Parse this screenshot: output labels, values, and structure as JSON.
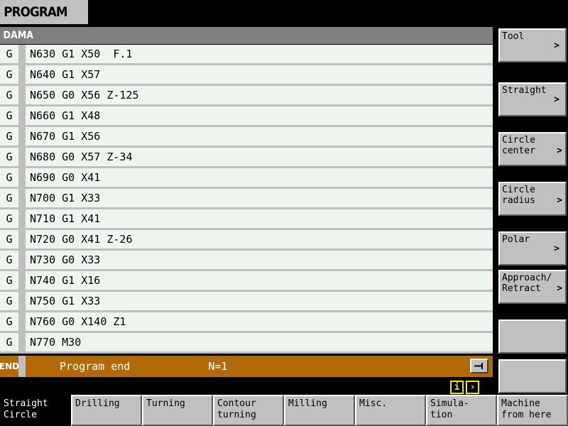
{
  "header": {
    "title": "PROGRAM",
    "program_name": "DAMA"
  },
  "program": {
    "block_marker": "G",
    "lines": [
      "N630 G1 X50  F.1",
      "N640 G1 X57",
      "N650 G0 X56 Z-125",
      "N660 G1 X48",
      "N670 G1 X56",
      "N680 G0 X57 Z-34",
      "N690 G0 X41",
      "N700 G1 X33",
      "N710 G1 X41",
      "N720 G0 X41 Z-26",
      "N730 G0 X33",
      "N740 G1 X16",
      "N750 G1 X33",
      "N760 G0 X140 Z1",
      "N770 M30"
    ],
    "end_row": {
      "badge": "END",
      "label": "Program end",
      "count": "N=1",
      "arrow_icon": "arrow-right-icon"
    },
    "row_bg_color": "#eef5ee",
    "end_bar_color": "#b26a08"
  },
  "sidebar": {
    "items": [
      {
        "label": "Tool",
        "chevron": ">",
        "chevron_style": "below"
      },
      {
        "label": "Straight",
        "chevron": ">",
        "chevron_style": "below"
      },
      {
        "label": "Circle\ncenter",
        "chevron": ">",
        "chevron_style": "inline"
      },
      {
        "label": "Circle\nradius",
        "chevron": ">",
        "chevron_style": "inline"
      },
      {
        "label": "Polar",
        "chevron": ">",
        "chevron_style": "below"
      },
      {
        "label": "Approach/\nRetract",
        "chevron": ">",
        "chevron_style": "inline"
      },
      {
        "label": "",
        "chevron": "",
        "chevron_style": "none"
      },
      {
        "label": "",
        "chevron": "",
        "chevron_style": "none"
      }
    ]
  },
  "nav_buttons": [
    {
      "icon": "info-icon",
      "glyph": "i"
    },
    {
      "icon": "chevron-right-icon",
      "glyph": "›"
    }
  ],
  "tabs": [
    {
      "label": "Straight\nCircle",
      "active": true
    },
    {
      "label": "Drilling",
      "active": false
    },
    {
      "label": "Turning",
      "active": false
    },
    {
      "label": "Contour\nturning",
      "active": false
    },
    {
      "label": "Milling",
      "active": false
    },
    {
      "label": "Misc.",
      "active": false
    },
    {
      "label": "Simula-\ntion",
      "active": false
    },
    {
      "label": "Machine\nfrom here",
      "active": false
    }
  ]
}
